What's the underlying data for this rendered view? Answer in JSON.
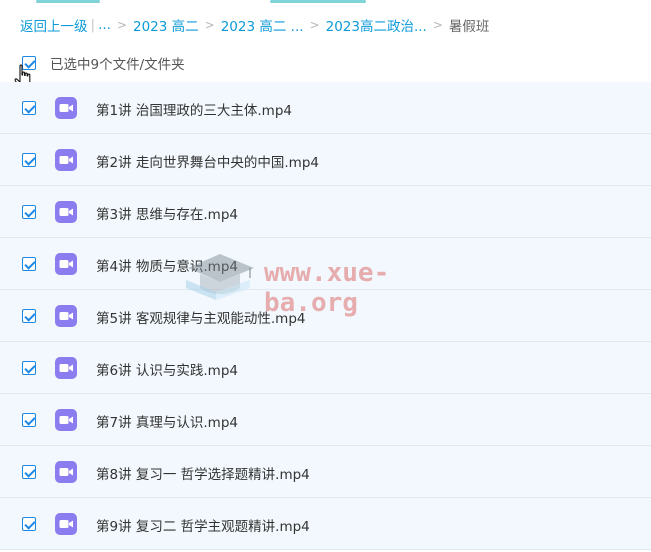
{
  "breadcrumb": {
    "back": "返回上一级",
    "ellipsis": "...",
    "items": [
      "2023 高二",
      "2023 高二 ...",
      "2023高二政治..."
    ],
    "current": "暑假班"
  },
  "selection": {
    "label": "已选中9个文件/文件夹"
  },
  "files": [
    {
      "name": "第1讲 治国理政的三大主体.mp4"
    },
    {
      "name": "第2讲 走向世界舞台中央的中国.mp4"
    },
    {
      "name": "第3讲 思维与存在.mp4"
    },
    {
      "name": "第4讲 物质与意识.mp4"
    },
    {
      "name": "第5讲 客观规律与主观能动性.mp4"
    },
    {
      "name": "第6讲 认识与实践.mp4"
    },
    {
      "name": "第7讲 真理与认识.mp4"
    },
    {
      "name": "第8讲 复习一 哲学选择题精讲.mp4"
    },
    {
      "name": "第9讲 复习二 哲学主观题精讲.mp4"
    }
  ],
  "watermark": {
    "text": "www.xue-ba.org"
  },
  "colors": {
    "link": "#0e9ad8",
    "checkbox": "#1e88e5",
    "video_icon": "#8b7cf0",
    "row_bg": "#f2f8fd"
  }
}
